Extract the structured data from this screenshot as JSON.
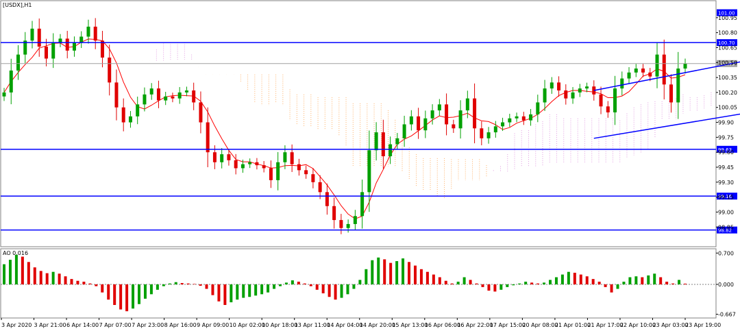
{
  "window": {
    "title": "[USDX],H1",
    "indicator_label": "AO 0.016"
  },
  "colors": {
    "bull": "#00a000",
    "bear": "#e00000",
    "ma": "#ff0000",
    "level": "#0000ff",
    "bid": "#a0a0a0",
    "cloud_a": "#ff9a3c",
    "cloud_b": "#d880d8"
  },
  "chart_data": [
    {
      "type": "line",
      "name": "price",
      "title": "[USDX],H1",
      "ylim": [
        98.68,
        101.1
      ],
      "y_ticks": [
        "100.95",
        "100.80",
        "100.65",
        "100.50",
        "100.35",
        "100.20",
        "100.05",
        "99.90",
        "99.75",
        "99.60",
        "99.45",
        "99.30",
        "99.15",
        "99.00",
        "98.85"
      ],
      "y_tick_values": [
        100.95,
        100.8,
        100.65,
        100.5,
        100.35,
        100.2,
        100.05,
        99.9,
        99.75,
        99.6,
        99.45,
        99.3,
        99.15,
        99.0,
        98.85
      ],
      "x_ticks": [
        "3 Apr 2020",
        "3 Apr 21:00",
        "6 Apr 14:00",
        "7 Apr 07:00",
        "7 Apr 23:00",
        "8 Apr 16:00",
        "9 Apr 09:00",
        "10 Apr 02:00",
        "10 Apr 18:00",
        "13 Apr 11:00",
        "14 Apr 04:00",
        "14 Apr 20:00",
        "15 Apr 13:00",
        "16 Apr 06:00",
        "16 Apr 22:00",
        "17 Apr 15:00",
        "20 Apr 08:00",
        "21 Apr 01:00",
        "21 Apr 17:00",
        "22 Apr 10:00",
        "23 Apr 03:00",
        "23 Apr 19:00"
      ],
      "levels": [
        {
          "label": "101.00",
          "value": 101.0
        },
        {
          "label": "100.70",
          "value": 100.7
        },
        {
          "label": "100.49",
          "value": 100.49
        },
        {
          "label": "99.63",
          "value": 99.63
        },
        {
          "label": "99.16",
          "value": 99.16
        },
        {
          "label": "98.82",
          "value": 98.82
        }
      ],
      "closes": [
        100.2,
        100.42,
        100.58,
        100.72,
        100.84,
        100.66,
        100.54,
        100.7,
        100.74,
        100.62,
        100.7,
        100.76,
        100.86,
        100.72,
        100.55,
        100.3,
        100.05,
        99.9,
        99.96,
        100.08,
        100.18,
        100.24,
        100.12,
        100.16,
        100.14,
        100.2,
        100.22,
        100.1,
        99.9,
        99.6,
        99.5,
        99.58,
        99.52,
        99.44,
        99.48,
        99.5,
        99.47,
        99.44,
        99.32,
        99.5,
        99.6,
        99.48,
        99.42,
        99.38,
        99.3,
        99.2,
        99.06,
        98.92,
        98.84,
        98.88,
        98.96,
        99.2,
        99.62,
        99.8,
        99.56,
        99.68,
        99.74,
        99.88,
        99.96,
        99.82,
        99.94,
        100.02,
        100.08,
        99.88,
        99.84,
        100.02,
        100.14,
        99.84,
        99.74,
        99.8,
        99.86,
        99.9,
        99.94,
        99.96,
        99.92,
        99.98,
        100.1,
        100.24,
        100.3,
        100.22,
        100.14,
        100.2,
        100.24,
        100.26,
        100.18,
        100.06,
        100.0,
        100.24,
        100.34,
        100.4,
        100.44,
        100.4,
        100.36,
        100.58,
        100.28,
        100.1,
        100.44,
        100.49
      ],
      "channel": [
        {
          "x1_index": 84,
          "y1": 100.22,
          "x2_index": 116,
          "y2": 100.66
        },
        {
          "x1_index": 84,
          "y1": 99.74,
          "x2_index": 120,
          "y2": 100.16
        }
      ]
    },
    {
      "type": "bar",
      "name": "AO",
      "title": "AO 0.016",
      "ylim": [
        -0.72,
        0.75
      ],
      "y_ticks": [
        "0.700",
        "0.000",
        "-0.667"
      ],
      "y_tick_values": [
        0.7,
        0.0,
        -0.667
      ],
      "current": 0.016,
      "values": [
        0.45,
        0.55,
        0.66,
        0.62,
        0.5,
        0.38,
        0.3,
        0.25,
        0.28,
        0.24,
        0.18,
        0.12,
        0.08,
        0.06,
        0.02,
        -0.04,
        -0.18,
        -0.34,
        -0.46,
        -0.56,
        -0.6,
        -0.54,
        -0.44,
        -0.32,
        -0.22,
        -0.12,
        -0.04,
        0.02,
        0.05,
        0.03,
        0.02,
        0.01,
        -0.03,
        -0.1,
        -0.24,
        -0.38,
        -0.46,
        -0.4,
        -0.34,
        -0.3,
        -0.28,
        -0.25,
        -0.22,
        -0.18,
        -0.1,
        -0.04,
        0.04,
        0.09,
        0.06,
        0.02,
        -0.04,
        -0.12,
        -0.2,
        -0.28,
        -0.34,
        -0.3,
        -0.22,
        -0.1,
        0.1,
        0.34,
        0.54,
        0.6,
        0.56,
        0.48,
        0.52,
        0.58,
        0.5,
        0.42,
        0.34,
        0.28,
        0.22,
        0.16,
        0.08,
        0.02,
        0.06,
        0.16,
        0.1,
        0.02,
        -0.06,
        -0.14,
        -0.16,
        -0.12,
        -0.06,
        -0.02,
        0.02,
        0.06,
        0.04,
        0.02,
        0.04,
        0.1,
        0.16,
        0.22,
        0.28,
        0.26,
        0.22,
        0.18,
        0.12,
        0.06,
        -0.06,
        -0.18,
        -0.1,
        0.06,
        0.16,
        0.18,
        0.16,
        0.2,
        0.24,
        0.16,
        0.06,
        0.02,
        0.1,
        0.016
      ]
    }
  ]
}
